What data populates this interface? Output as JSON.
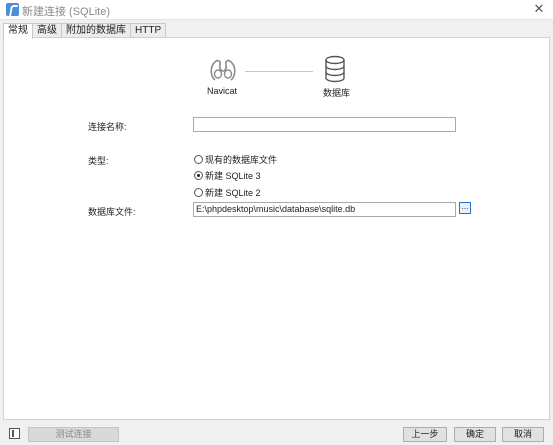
{
  "window": {
    "title": "新建连接 (SQLite)"
  },
  "tabs": [
    {
      "label": "常规"
    },
    {
      "label": "高级"
    },
    {
      "label": "附加的数据库"
    },
    {
      "label": "HTTP"
    }
  ],
  "steps": {
    "navicat_label": "Navicat",
    "database_label": "数据库"
  },
  "form": {
    "connection_name_label": "连接名称:",
    "connection_name_value": "",
    "type_label": "类型:",
    "type_options": [
      {
        "label": "现有的数据库文件",
        "checked": false
      },
      {
        "label": "新建 SQLite 3",
        "checked": true
      },
      {
        "label": "新建 SQLite 2",
        "checked": false
      }
    ],
    "db_file_label": "数据库文件:",
    "db_file_value": "E:\\phpdesktop\\music\\database\\sqlite.db",
    "browse_label": "..."
  },
  "footer": {
    "test_button": "测试连接",
    "prev_button": "上一步",
    "ok_button": "确定",
    "cancel_button": "取消"
  }
}
